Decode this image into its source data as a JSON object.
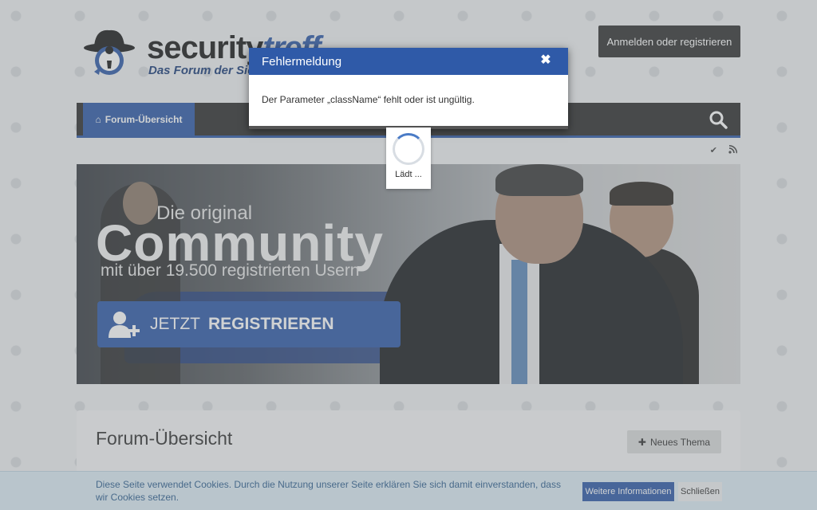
{
  "header": {
    "logo_main": "security",
    "logo_accent": "treff",
    "logo_sub": "Das Forum der Sic",
    "login_label": "Anmelden oder registrieren"
  },
  "nav": {
    "tab_label": "Forum-Übersicht"
  },
  "banner": {
    "line1": "Die original",
    "line2": "Community",
    "line3": "mit über 19.500 registrierten Usern",
    "cta_prefix": "JETZT",
    "cta_bold": "REGISTRIEREN"
  },
  "content": {
    "title": "Forum-Übersicht",
    "new_thread_label": "Neues Thema"
  },
  "cookie": {
    "text": "Diese Seite verwendet Cookies. Durch die Nutzung unserer Seite erklären Sie sich damit einverstanden, dass wir Cookies setzen.",
    "more_label": "Weitere Informationen",
    "close_label": "Schließen"
  },
  "dialog": {
    "title": "Fehlermeldung",
    "message": "Der Parameter „className“ fehlt oder ist ungültig.",
    "close_glyph": "✖"
  },
  "loading": {
    "label": "Lädt ..."
  },
  "colors": {
    "brand_blue": "#2f5aa8",
    "dark_nav": "#2f2f2f"
  }
}
